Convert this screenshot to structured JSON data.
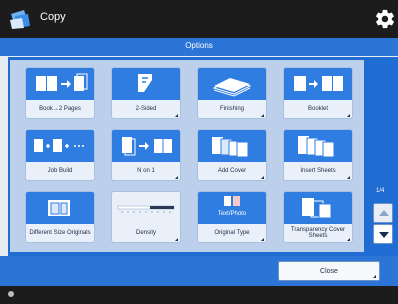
{
  "title_bar": {
    "app_title": "Copy",
    "app_icon": "copy-icon",
    "settings_icon": "gear-icon"
  },
  "options": {
    "label": "Options"
  },
  "tiles": [
    {
      "label": "Book→2 Pages",
      "icon": "book-to-two-pages-icon"
    },
    {
      "label": "2-Sided",
      "icon": "two-sided-icon"
    },
    {
      "label": "Finishing",
      "icon": "finishing-icon"
    },
    {
      "label": "Booklet",
      "icon": "booklet-icon"
    },
    {
      "label": "Job Build",
      "icon": "job-build-icon"
    },
    {
      "label": "N on 1",
      "icon": "n-on-1-icon"
    },
    {
      "label": "Add Cover",
      "icon": "add-cover-icon"
    },
    {
      "label": "Insert Sheets",
      "icon": "insert-sheets-icon"
    },
    {
      "label": "Different Size Originals",
      "icon": "different-size-originals-icon"
    },
    {
      "label": "Density",
      "icon": "density-icon"
    },
    {
      "label": "Original Type",
      "icon": "original-type-icon",
      "icon_text": "Text/Photo"
    },
    {
      "label": "Transparency Cover Sheets",
      "icon": "transparency-cover-sheets-icon"
    }
  ],
  "pagination": {
    "page": "1/4"
  },
  "footer": {
    "close_label": "Close"
  },
  "colors": {
    "header": "#1c1c1c",
    "accent": "#2c74d6",
    "tile_icon_bg": "#2f7de0",
    "panel": "#1f6cd3"
  }
}
